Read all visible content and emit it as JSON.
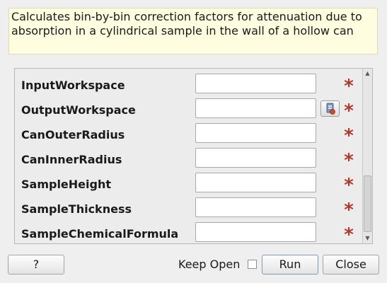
{
  "description": "Calculates bin-by-bin correction factors for attenuation due to absorption in a cylindrical sample in the wall of a hollow can",
  "properties": [
    {
      "label": "InputWorkspace",
      "value": "",
      "has_browse": false
    },
    {
      "label": "OutputWorkspace",
      "value": "",
      "has_browse": true
    },
    {
      "label": "CanOuterRadius",
      "value": "",
      "has_browse": false
    },
    {
      "label": "CanInnerRadius",
      "value": "",
      "has_browse": false
    },
    {
      "label": "SampleHeight",
      "value": "",
      "has_browse": false
    },
    {
      "label": "SampleThickness",
      "value": "",
      "has_browse": false
    },
    {
      "label": "SampleChemicalFormula",
      "value": "",
      "has_browse": false
    }
  ],
  "required_marker": "*",
  "buttons": {
    "help": "?",
    "keep_open": "Keep Open",
    "run": "Run",
    "close": "Close"
  },
  "keep_open_checked": false,
  "colors": {
    "required_star": "#b03a2a",
    "description_bg": "#fffde0"
  },
  "icons": {
    "browse": "workspace-browse-icon",
    "scroll_up": "scroll-up-arrow-icon",
    "scroll_down": "scroll-down-arrow-icon"
  }
}
